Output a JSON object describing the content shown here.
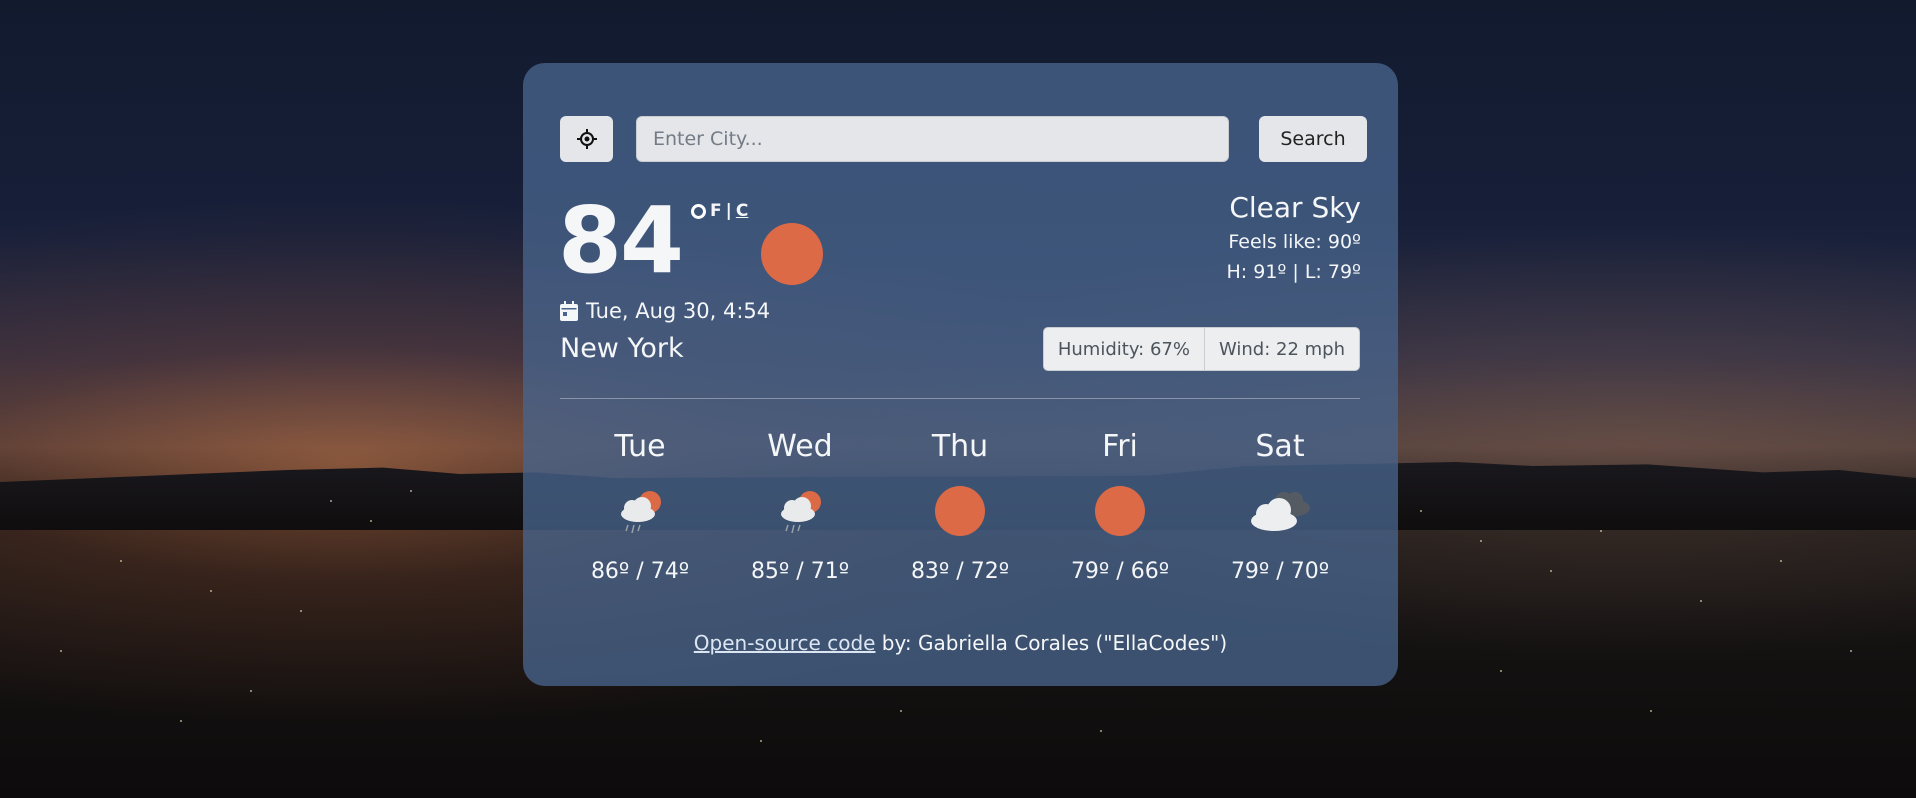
{
  "search": {
    "placeholder": "Enter City...",
    "button_label": "Search"
  },
  "current": {
    "temperature": "84",
    "unit_f": "F",
    "unit_separator": "|",
    "unit_c": "C",
    "datetime": "Tue, Aug 30, 4:54",
    "city": "New York",
    "condition": "Clear Sky",
    "feels_like": "Feels like: 90º",
    "high_low": "H: 91º | L: 79º",
    "humidity": "Humidity: 67%",
    "wind": "Wind: 22 mph",
    "icon": "sun-icon"
  },
  "forecast": [
    {
      "day": "Tue",
      "temps": "86º / 74º",
      "icon": "rain-cloud-sun-icon"
    },
    {
      "day": "Wed",
      "temps": "85º / 71º",
      "icon": "rain-cloud-sun-icon"
    },
    {
      "day": "Thu",
      "temps": "83º / 72º",
      "icon": "sun-icon"
    },
    {
      "day": "Fri",
      "temps": "79º / 66º",
      "icon": "sun-icon"
    },
    {
      "day": "Sat",
      "temps": "79º / 70º",
      "icon": "clouds-icon"
    }
  ],
  "footer": {
    "link_text": "Open-source code",
    "credit": " by: Gabriella Corales (\"EllaCodes\")"
  },
  "colors": {
    "sun": "#dc6a47",
    "card": "#48648c",
    "text": "#f4f6f8"
  }
}
